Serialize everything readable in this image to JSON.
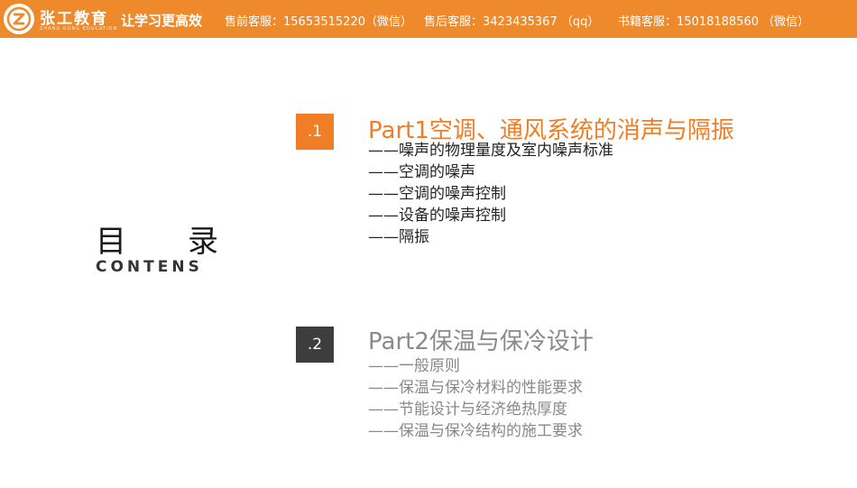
{
  "header": {
    "brand_name": "张工教育",
    "brand_sub": "ZHANG GONG EDUCATION",
    "slogan": "让学习更高效",
    "contacts": [
      "售前客服：15653515220（微信）",
      "售后客服：3423435367 （qq）",
      "书籍客服：15018188560 （微信）"
    ],
    "colors": {
      "accent": "#ef8a2c"
    }
  },
  "toc": {
    "title_chars": [
      "目",
      "录"
    ],
    "subtitle": "CONTENS"
  },
  "sections": [
    {
      "badge": ".1",
      "title": "Part1空调、通风系统的消声与隔振",
      "items": [
        "——噪声的物理量度及室内噪声标准",
        "——空调的噪声",
        "——空调的噪声控制",
        "——设备的噪声控制",
        "——隔振"
      ],
      "color": "#ef7e26"
    },
    {
      "badge": ".2",
      "title": "Part2保温与保冷设计",
      "items": [
        "——一般原则",
        "——保温与保冷材料的性能要求",
        "——节能设计与经济绝热厚度",
        "——保温与保冷结构的施工要求"
      ],
      "color": "#3d3d3d"
    }
  ]
}
